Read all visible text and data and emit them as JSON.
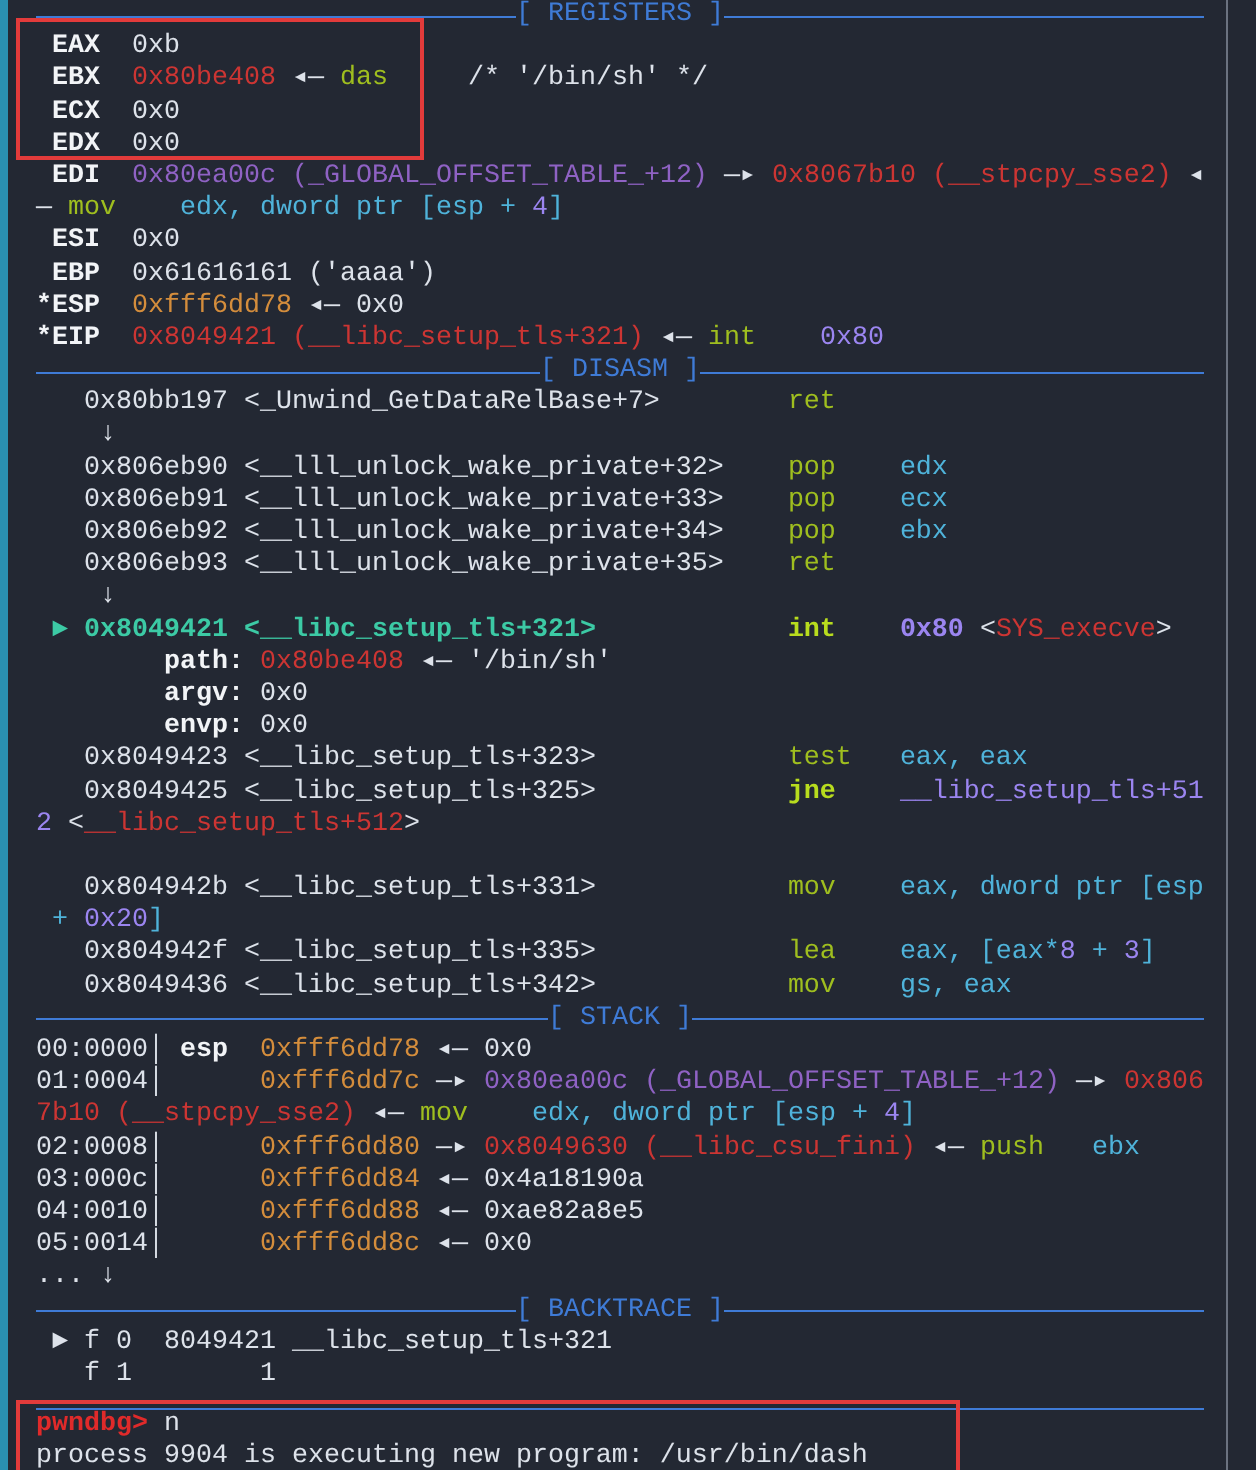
{
  "blocks": [
    {
      "highlighted": false,
      "lines": [
        {
          "kind": "header",
          "title": "[ REGISTERS ]"
        }
      ]
    },
    {
      "highlighted": true,
      "lines": [
        {
          "kind": "text",
          "spans": [
            {
              "kind": "reg",
              "text": " EAX"
            },
            {
              "kind": "plain",
              "text": "  0xb"
            }
          ]
        },
        {
          "kind": "text",
          "spans": [
            {
              "kind": "reg",
              "text": " EBX"
            },
            {
              "kind": "red",
              "text": "  0x80be408"
            },
            {
              "kind": "plain",
              "text": " ◂— "
            },
            {
              "kind": "green",
              "text": "das"
            },
            {
              "kind": "plain",
              "text": "     /* '/bin/sh' */"
            }
          ]
        },
        {
          "kind": "text",
          "spans": [
            {
              "kind": "reg",
              "text": " ECX"
            },
            {
              "kind": "plain",
              "text": "  0x0"
            }
          ]
        },
        {
          "kind": "text",
          "spans": [
            {
              "kind": "reg",
              "text": " EDX"
            },
            {
              "kind": "plain",
              "text": "  0x0"
            }
          ]
        }
      ]
    },
    {
      "highlighted": false,
      "lines": [
        {
          "kind": "text",
          "spans": [
            {
              "kind": "reg",
              "text": " EDI"
            },
            {
              "kind": "purple",
              "text": "  0x80ea00c (_GLOBAL_OFFSET_TABLE_+12)"
            },
            {
              "kind": "plain",
              "text": " —▸ "
            },
            {
              "kind": "red",
              "text": "0x8067b10 (__stpcpy_sse2)"
            },
            {
              "kind": "plain",
              "text": " ◂"
            }
          ]
        },
        {
          "kind": "text",
          "spans": [
            {
              "kind": "plain",
              "text": "—"
            },
            {
              "kind": "green",
              "text": " mov"
            },
            {
              "kind": "cyan",
              "text": "    edx, dword ptr [esp + "
            },
            {
              "kind": "lavender",
              "text": "4"
            },
            {
              "kind": "cyan",
              "text": "]"
            }
          ]
        },
        {
          "kind": "text",
          "spans": [
            {
              "kind": "reg",
              "text": " ESI"
            },
            {
              "kind": "plain",
              "text": "  0x0"
            }
          ]
        },
        {
          "kind": "text",
          "spans": [
            {
              "kind": "reg",
              "text": " EBP"
            },
            {
              "kind": "plain",
              "text": "  0x61616161 ('aaaa')"
            }
          ]
        },
        {
          "kind": "text",
          "spans": [
            {
              "kind": "reg",
              "text": "*ESP"
            },
            {
              "kind": "orange",
              "text": "  0xfff6dd78"
            },
            {
              "kind": "plain",
              "text": " ◂— 0x0"
            }
          ]
        },
        {
          "kind": "text",
          "spans": [
            {
              "kind": "reg",
              "text": "*EIP"
            },
            {
              "kind": "red",
              "text": "  0x8049421 (__libc_setup_tls+321)"
            },
            {
              "kind": "plain",
              "text": " ◂— "
            },
            {
              "kind": "green",
              "text": "int"
            },
            {
              "kind": "lavender",
              "text": "    0x80"
            }
          ]
        },
        {
          "kind": "header",
          "title": "[ DISASM ]"
        },
        {
          "kind": "text",
          "spans": [
            {
              "kind": "plain",
              "text": "   0x80bb197 <_Unwind_GetDataRelBase+7>"
            },
            {
              "kind": "green",
              "text": "        ret"
            }
          ]
        },
        {
          "kind": "text",
          "spans": [
            {
              "kind": "plain",
              "text": "    ↓"
            }
          ]
        },
        {
          "kind": "text",
          "spans": [
            {
              "kind": "plain",
              "text": "   0x806eb90 <__lll_unlock_wake_private+32>"
            },
            {
              "kind": "green",
              "text": "    pop"
            },
            {
              "kind": "cyan",
              "text": "    edx"
            }
          ]
        },
        {
          "kind": "text",
          "spans": [
            {
              "kind": "plain",
              "text": "   0x806eb91 <__lll_unlock_wake_private+33>"
            },
            {
              "kind": "green",
              "text": "    pop"
            },
            {
              "kind": "cyan",
              "text": "    ecx"
            }
          ]
        },
        {
          "kind": "text",
          "spans": [
            {
              "kind": "plain",
              "text": "   0x806eb92 <__lll_unlock_wake_private+34>"
            },
            {
              "kind": "green",
              "text": "    pop"
            },
            {
              "kind": "cyan",
              "text": "    ebx"
            }
          ]
        },
        {
          "kind": "text",
          "spans": [
            {
              "kind": "plain",
              "text": "   0x806eb93 <__lll_unlock_wake_private+35>"
            },
            {
              "kind": "green",
              "text": "    ret"
            }
          ]
        },
        {
          "kind": "text",
          "spans": [
            {
              "kind": "plain",
              "text": "    ↓"
            }
          ]
        },
        {
          "kind": "text",
          "spans": [
            {
              "kind": "marker",
              "text": " ►"
            },
            {
              "kind": "current",
              "text": " 0x8049421 <__libc_setup_tls+321>"
            },
            {
              "kind": "boldgreen",
              "text": "            int"
            },
            {
              "kind": "boldlavender",
              "text": "    0x80"
            },
            {
              "kind": "plain",
              "text": " <"
            },
            {
              "kind": "red",
              "text": "SYS_execve"
            },
            {
              "kind": "plain",
              "text": ">"
            }
          ]
        },
        {
          "kind": "text",
          "spans": [
            {
              "kind": "bold",
              "text": "        path:"
            },
            {
              "kind": "red",
              "text": " 0x80be408"
            },
            {
              "kind": "plain",
              "text": " ◂— '/bin/sh'"
            }
          ]
        },
        {
          "kind": "text",
          "spans": [
            {
              "kind": "bold",
              "text": "        argv:"
            },
            {
              "kind": "plain",
              "text": " 0x0"
            }
          ]
        },
        {
          "kind": "text",
          "spans": [
            {
              "kind": "bold",
              "text": "        envp:"
            },
            {
              "kind": "plain",
              "text": " 0x0"
            }
          ]
        },
        {
          "kind": "text",
          "spans": [
            {
              "kind": "plain",
              "text": "   0x8049423 <__libc_setup_tls+323>"
            },
            {
              "kind": "green",
              "text": "            test"
            },
            {
              "kind": "cyan",
              "text": "   eax, eax"
            }
          ]
        },
        {
          "kind": "text",
          "spans": [
            {
              "kind": "plain",
              "text": "   0x8049425 <__libc_setup_tls+325>"
            },
            {
              "kind": "boldgreen",
              "text": "            jne"
            },
            {
              "kind": "lavender",
              "text": "    __libc_setup_tls+51"
            }
          ]
        },
        {
          "kind": "text",
          "spans": [
            {
              "kind": "lavender",
              "text": "2"
            },
            {
              "kind": "plain",
              "text": " <"
            },
            {
              "kind": "red",
              "text": "__libc_setup_tls+512"
            },
            {
              "kind": "plain",
              "text": ">"
            }
          ]
        },
        {
          "kind": "blank"
        },
        {
          "kind": "text",
          "spans": [
            {
              "kind": "plain",
              "text": "   0x804942b <__libc_setup_tls+331>"
            },
            {
              "kind": "green",
              "text": "            mov"
            },
            {
              "kind": "cyan",
              "text": "    eax, dword ptr [esp"
            }
          ]
        },
        {
          "kind": "text",
          "spans": [
            {
              "kind": "cyan",
              "text": " +"
            },
            {
              "kind": "lavender",
              "text": " 0x20"
            },
            {
              "kind": "cyan",
              "text": "]"
            }
          ]
        },
        {
          "kind": "text",
          "spans": [
            {
              "kind": "plain",
              "text": "   0x804942f <__libc_setup_tls+335>"
            },
            {
              "kind": "green",
              "text": "            lea"
            },
            {
              "kind": "cyan",
              "text": "    eax, [eax*"
            },
            {
              "kind": "lavender",
              "text": "8"
            },
            {
              "kind": "cyan",
              "text": " + "
            },
            {
              "kind": "lavender",
              "text": "3"
            },
            {
              "kind": "cyan",
              "text": "]"
            }
          ]
        },
        {
          "kind": "text",
          "spans": [
            {
              "kind": "plain",
              "text": "   0x8049436 <__libc_setup_tls+342>"
            },
            {
              "kind": "green",
              "text": "            mov"
            },
            {
              "kind": "cyan",
              "text": "    gs, eax"
            }
          ]
        },
        {
          "kind": "header",
          "title": "[ STACK ]"
        },
        {
          "kind": "text",
          "spans": [
            {
              "kind": "plain",
              "text": "00:0000│"
            },
            {
              "kind": "bold",
              "text": " esp"
            },
            {
              "kind": "orange",
              "text": "  0xfff6dd78"
            },
            {
              "kind": "plain",
              "text": " ◂— 0x0"
            }
          ]
        },
        {
          "kind": "text",
          "spans": [
            {
              "kind": "plain",
              "text": "01:0004│"
            },
            {
              "kind": "orange",
              "text": "      0xfff6dd7c"
            },
            {
              "kind": "plain",
              "text": " —▸ "
            },
            {
              "kind": "purple",
              "text": "0x80ea00c (_GLOBAL_OFFSET_TABLE_+12)"
            },
            {
              "kind": "plain",
              "text": " —▸ "
            },
            {
              "kind": "red",
              "text": "0x806"
            }
          ]
        },
        {
          "kind": "text",
          "spans": [
            {
              "kind": "red",
              "text": "7b10 (__stpcpy_sse2)"
            },
            {
              "kind": "plain",
              "text": " ◂— "
            },
            {
              "kind": "green",
              "text": "mov"
            },
            {
              "kind": "cyan",
              "text": "    edx, dword ptr [esp + "
            },
            {
              "kind": "lavender",
              "text": "4"
            },
            {
              "kind": "cyan",
              "text": "]"
            }
          ]
        },
        {
          "kind": "text",
          "spans": [
            {
              "kind": "plain",
              "text": "02:0008│"
            },
            {
              "kind": "orange",
              "text": "      0xfff6dd80"
            },
            {
              "kind": "plain",
              "text": " —▸ "
            },
            {
              "kind": "red",
              "text": "0x8049630 (__libc_csu_fini)"
            },
            {
              "kind": "plain",
              "text": " ◂— "
            },
            {
              "kind": "green",
              "text": "push"
            },
            {
              "kind": "cyan",
              "text": "   ebx"
            }
          ]
        },
        {
          "kind": "text",
          "spans": [
            {
              "kind": "plain",
              "text": "03:000c│"
            },
            {
              "kind": "orange",
              "text": "      0xfff6dd84"
            },
            {
              "kind": "plain",
              "text": " ◂— 0x4a18190a"
            }
          ]
        },
        {
          "kind": "text",
          "spans": [
            {
              "kind": "plain",
              "text": "04:0010│"
            },
            {
              "kind": "orange",
              "text": "      0xfff6dd88"
            },
            {
              "kind": "plain",
              "text": " ◂— 0xae82a8e5"
            }
          ]
        },
        {
          "kind": "text",
          "spans": [
            {
              "kind": "plain",
              "text": "05:0014│"
            },
            {
              "kind": "orange",
              "text": "      0xfff6dd8c"
            },
            {
              "kind": "plain",
              "text": " ◂— 0x0"
            }
          ]
        },
        {
          "kind": "text",
          "spans": [
            {
              "kind": "plain",
              "text": "... ↓"
            }
          ]
        },
        {
          "kind": "header",
          "title": "[ BACKTRACE ]"
        },
        {
          "kind": "text",
          "spans": [
            {
              "kind": "plain",
              "text": " ► f 0  8049421 __libc_setup_tls+321"
            }
          ]
        },
        {
          "kind": "text",
          "spans": [
            {
              "kind": "plain",
              "text": "   f 1        1"
            }
          ]
        },
        {
          "kind": "divider"
        }
      ]
    },
    {
      "highlighted": true,
      "lines": [
        {
          "kind": "text",
          "spans": [
            {
              "kind": "prompt",
              "text": "pwndbg>"
            },
            {
              "kind": "plain",
              "text": " n"
            }
          ]
        },
        {
          "kind": "text",
          "spans": [
            {
              "kind": "plain",
              "text": "process 9904 is executing new program: /usr/bin/dash"
            }
          ]
        }
      ]
    }
  ]
}
